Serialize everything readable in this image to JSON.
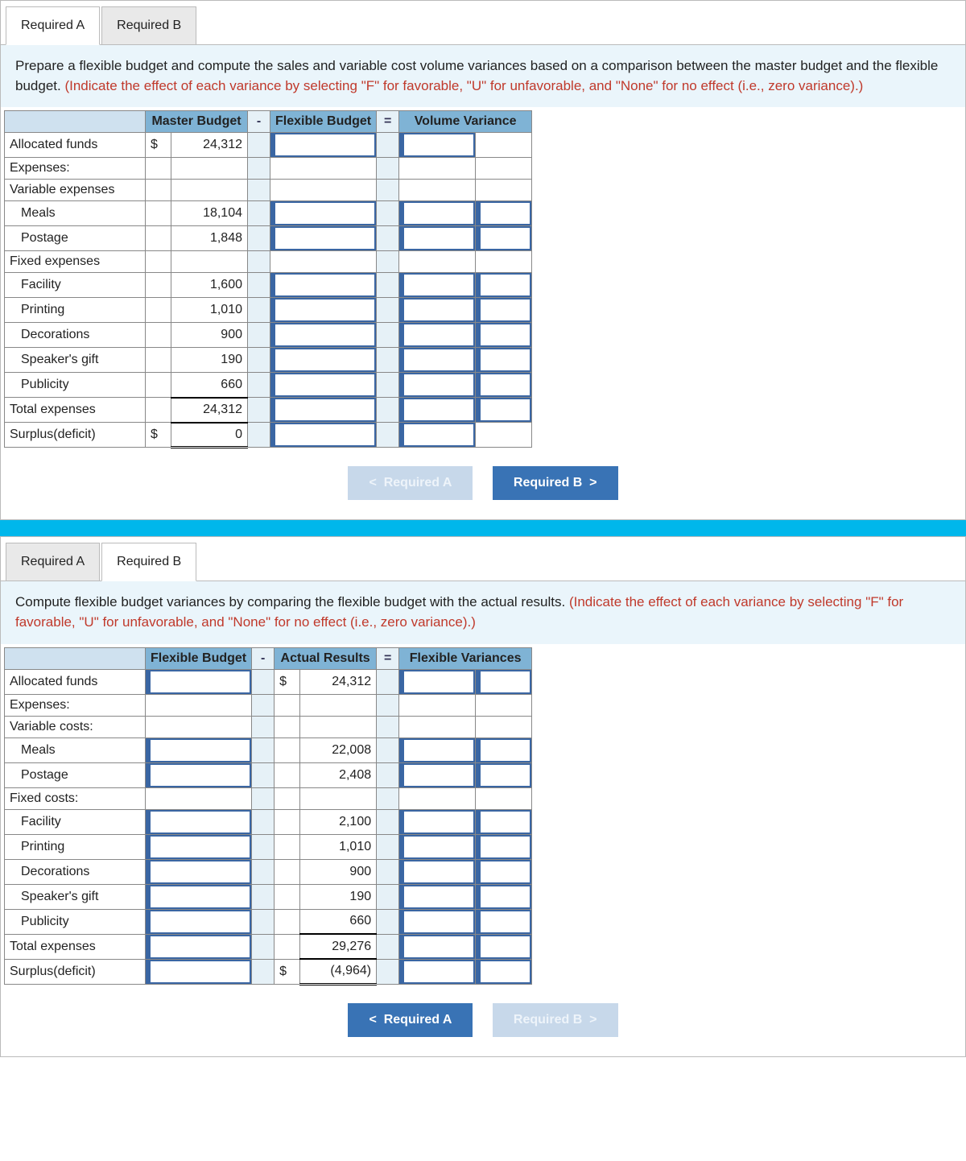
{
  "partA": {
    "tabs": {
      "a": "Required A",
      "b": "Required B",
      "active": "a"
    },
    "prompt": {
      "main": "Prepare a flexible budget and compute the sales and variable cost volume variances based on a comparison between the master budget and the flexible budget. ",
      "instr": "(Indicate the effect of each variance by selecting \"F\" for favorable, \"U\" for unfavorable, and \"None\" for no effect (i.e., zero variance).)"
    },
    "headers": {
      "col1": "Master Budget",
      "op1": "-",
      "col2": "Flexible Budget",
      "op2": "=",
      "col3": "Volume Variance"
    },
    "rows": [
      {
        "label": "Allocated funds",
        "indent": false,
        "pfx": "$",
        "val": "24,312",
        "flex": true,
        "var": true,
        "sel": false
      },
      {
        "label": "Expenses:",
        "indent": false,
        "pfx": "",
        "val": "",
        "flex": false,
        "var": false,
        "sel": false
      },
      {
        "label": "Variable expenses",
        "indent": false,
        "pfx": "",
        "val": "",
        "flex": false,
        "var": false,
        "sel": false
      },
      {
        "label": "Meals",
        "indent": true,
        "pfx": "",
        "val": "18,104",
        "flex": true,
        "var": true,
        "sel": true
      },
      {
        "label": "Postage",
        "indent": true,
        "pfx": "",
        "val": "1,848",
        "flex": true,
        "var": true,
        "sel": true
      },
      {
        "label": "Fixed expenses",
        "indent": false,
        "pfx": "",
        "val": "",
        "flex": false,
        "var": false,
        "sel": false
      },
      {
        "label": "Facility",
        "indent": true,
        "pfx": "",
        "val": "1,600",
        "flex": true,
        "var": true,
        "sel": true
      },
      {
        "label": "Printing",
        "indent": true,
        "pfx": "",
        "val": "1,010",
        "flex": true,
        "var": true,
        "sel": true
      },
      {
        "label": "Decorations",
        "indent": true,
        "pfx": "",
        "val": "900",
        "flex": true,
        "var": true,
        "sel": true
      },
      {
        "label": "Speaker's gift",
        "indent": true,
        "pfx": "",
        "val": "190",
        "flex": true,
        "var": true,
        "sel": true
      },
      {
        "label": "Publicity",
        "indent": true,
        "pfx": "",
        "val": "660",
        "flex": true,
        "var": true,
        "sel": true
      },
      {
        "label": "Total expenses",
        "indent": false,
        "pfx": "",
        "val": "24,312",
        "flex": true,
        "var": true,
        "sel": true,
        "total": true
      },
      {
        "label": "Surplus(deficit)",
        "indent": false,
        "pfx": "$",
        "val": "0",
        "flex": true,
        "var": true,
        "sel": false,
        "double": true
      }
    ],
    "nav": {
      "prev": "Required A",
      "next": "Required B",
      "prevEnabled": false,
      "nextEnabled": true
    }
  },
  "partB": {
    "tabs": {
      "a": "Required A",
      "b": "Required B",
      "active": "b"
    },
    "prompt": {
      "main": "Compute flexible budget variances by comparing the flexible budget with the actual  results. ",
      "instr": "(Indicate the effect of each variance by selecting \"F\" for favorable, \"U\" for unfavorable, and \"None\" for no effect (i.e., zero variance).)"
    },
    "headers": {
      "col1": "Flexible Budget",
      "op1": "-",
      "col2": "Actual Results",
      "op2": "=",
      "col3": "Flexible Variances"
    },
    "rows": [
      {
        "label": "Allocated funds",
        "indent": false,
        "flex": true,
        "pfx": "$",
        "val": "24,312",
        "var": true,
        "sel": true
      },
      {
        "label": "Expenses:",
        "indent": false,
        "flex": false,
        "pfx": "",
        "val": "",
        "var": false,
        "sel": false
      },
      {
        "label": "Variable costs:",
        "indent": false,
        "flex": false,
        "pfx": "",
        "val": "",
        "var": false,
        "sel": false
      },
      {
        "label": "Meals",
        "indent": true,
        "flex": true,
        "pfx": "",
        "val": "22,008",
        "var": true,
        "sel": true
      },
      {
        "label": "Postage",
        "indent": true,
        "flex": true,
        "pfx": "",
        "val": "2,408",
        "var": true,
        "sel": true
      },
      {
        "label": "Fixed costs:",
        "indent": false,
        "flex": false,
        "pfx": "",
        "val": "",
        "var": false,
        "sel": false
      },
      {
        "label": "Facility",
        "indent": true,
        "flex": true,
        "pfx": "",
        "val": "2,100",
        "var": true,
        "sel": true
      },
      {
        "label": "Printing",
        "indent": true,
        "flex": true,
        "pfx": "",
        "val": "1,010",
        "var": true,
        "sel": true
      },
      {
        "label": "Decorations",
        "indent": true,
        "flex": true,
        "pfx": "",
        "val": "900",
        "var": true,
        "sel": true
      },
      {
        "label": "Speaker's gift",
        "indent": true,
        "flex": true,
        "pfx": "",
        "val": "190",
        "var": true,
        "sel": true
      },
      {
        "label": "Publicity",
        "indent": true,
        "flex": true,
        "pfx": "",
        "val": "660",
        "var": true,
        "sel": true
      },
      {
        "label": "Total expenses",
        "indent": false,
        "flex": true,
        "pfx": "",
        "val": "29,276",
        "var": true,
        "sel": true,
        "total": true
      },
      {
        "label": "Surplus(deficit)",
        "indent": false,
        "flex": true,
        "pfx": "$",
        "val": "(4,964)",
        "var": true,
        "sel": true,
        "double": true
      }
    ],
    "nav": {
      "prev": "Required A",
      "next": "Required B",
      "prevEnabled": true,
      "nextEnabled": false
    }
  },
  "chevrons": {
    "left": "<",
    "right": ">"
  }
}
